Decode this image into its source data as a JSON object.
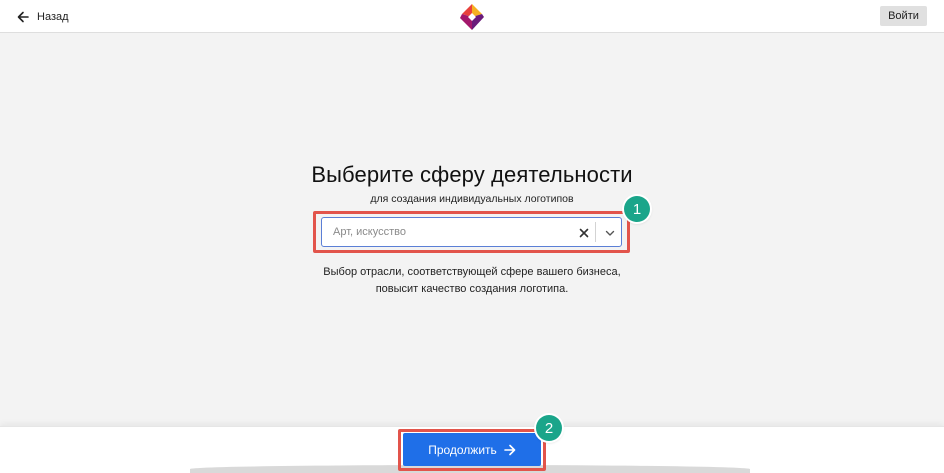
{
  "header": {
    "back_label": "Назад",
    "login_label": "Войти",
    "back_icon": "arrow-left-icon",
    "logo_icon": "brand-logo-icon",
    "logo_colors": [
      "#f5b021",
      "#e8413c",
      "#a3176b",
      "#6a1a7a"
    ]
  },
  "main": {
    "title": "Выберите сферу деятельности",
    "subtitle": "для создания индивидуальных логотипов",
    "industry_field": {
      "value": "",
      "placeholder": "Арт, искусство",
      "clear_icon": "close-icon",
      "dropdown_icon": "chevron-down-icon"
    },
    "hint_line1": "Выбор отрасли, соответствующей сфере вашего бизнеса,",
    "hint_line2": "повысит качество создания логотипа."
  },
  "footer": {
    "continue_label": "Продолжить",
    "continue_icon": "arrow-right-icon"
  },
  "annotations": {
    "badge_1": "1",
    "badge_2": "2",
    "highlight_color": "#e2544b",
    "badge_color": "#1aa58a"
  },
  "colors": {
    "primary": "#1f6fe8",
    "page_bg": "#f3f3f3",
    "field_border": "#5b7fd6"
  }
}
